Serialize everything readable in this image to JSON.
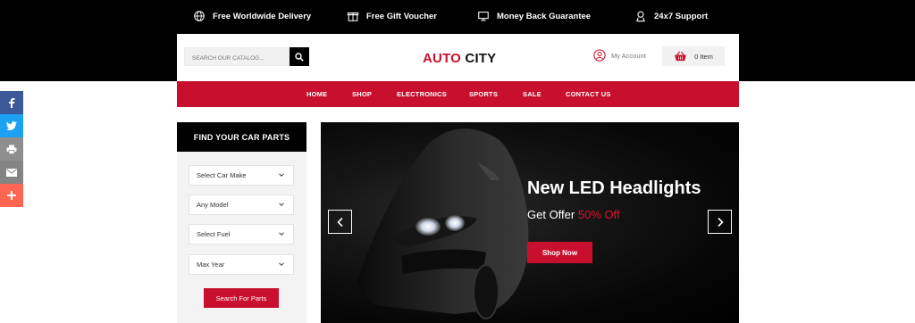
{
  "topbar": {
    "features": [
      {
        "label": "Free Worldwide Delivery",
        "icon": "globe-icon"
      },
      {
        "label": "Free Gift Voucher",
        "icon": "gift-icon"
      },
      {
        "label": "Money Back Guarantee",
        "icon": "money-icon"
      },
      {
        "label": "24x7 Support",
        "icon": "support-icon"
      }
    ]
  },
  "header": {
    "search_placeholder": "SEARCH OUR CATALOG...",
    "logo_part1": "AUTO",
    "logo_part2": "CITY",
    "account_label": "My Account",
    "cart_label": "0 Item"
  },
  "nav": {
    "items": [
      "HOME",
      "SHOP",
      "ELECTRONICS",
      "SPORTS",
      "SALE",
      "CONTACT US"
    ]
  },
  "social": {
    "items": [
      {
        "icon": "facebook-icon",
        "color": "#3b5998"
      },
      {
        "icon": "twitter-icon",
        "color": "#1da1f2"
      },
      {
        "icon": "print-icon",
        "color": "#8f8f8f"
      },
      {
        "icon": "email-icon",
        "color": "#848484"
      },
      {
        "icon": "plus-icon",
        "color": "#ff6550"
      }
    ]
  },
  "finder": {
    "title": "FIND YOUR CAR PARTS",
    "selects": [
      "Select Car Make",
      "Any Model",
      "Select Fuel",
      "Max Year"
    ],
    "button": "Search For Parts"
  },
  "hero": {
    "title": "New LED Headlights",
    "subtitle": "Get Offer",
    "highlight": "50% Off",
    "button": "Shop Now"
  },
  "colors": {
    "brand": "#c8102e",
    "dark": "#000000",
    "panel": "#f3f3f3"
  }
}
